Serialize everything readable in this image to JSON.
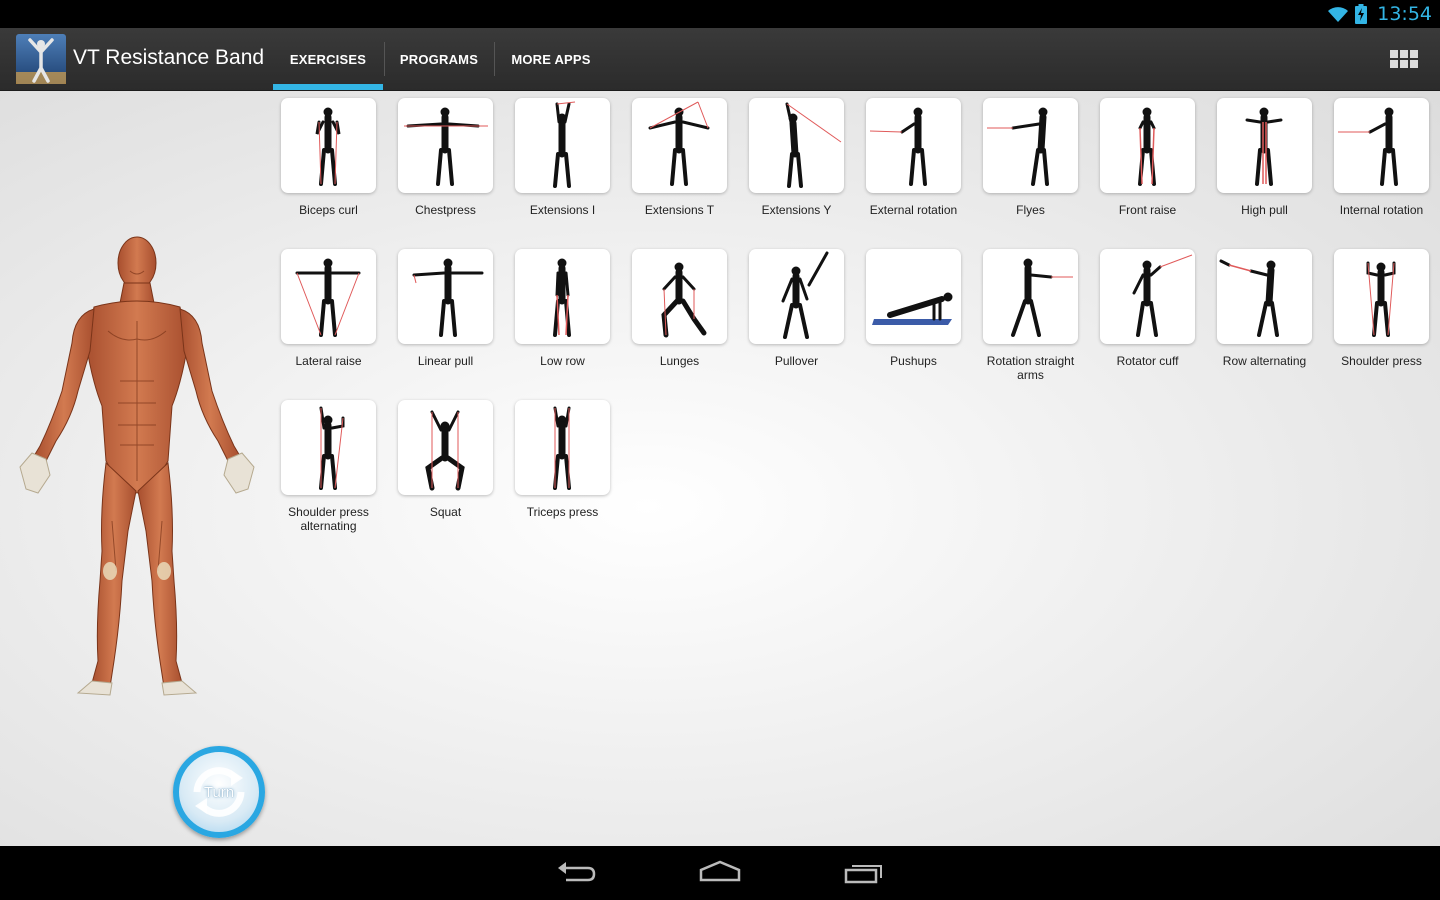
{
  "status_bar": {
    "time": "13:54",
    "icons": [
      "wifi-icon",
      "battery-charging-icon"
    ]
  },
  "app": {
    "title": "VT Resistance Band",
    "logo_icon": "muscle-figure-logo-icon"
  },
  "tabs": [
    {
      "label": "EXERCISES",
      "selected": true
    },
    {
      "label": "PROGRAMS",
      "selected": false
    },
    {
      "label": "MORE APPS",
      "selected": false
    }
  ],
  "menu_icon": "grid-view-icon",
  "turn_button": {
    "label": "Turn"
  },
  "exercises": [
    {
      "label": "Biceps curl"
    },
    {
      "label": "Chestpress"
    },
    {
      "label": "Extensions I"
    },
    {
      "label": "Extensions T"
    },
    {
      "label": "Extensions Y"
    },
    {
      "label": "External rotation"
    },
    {
      "label": "Flyes"
    },
    {
      "label": "Front raise"
    },
    {
      "label": "High pull"
    },
    {
      "label": "Internal rotation"
    },
    {
      "label": "Lateral raise"
    },
    {
      "label": "Linear pull"
    },
    {
      "label": "Low row"
    },
    {
      "label": "Lunges"
    },
    {
      "label": "Pullover"
    },
    {
      "label": "Pushups"
    },
    {
      "label": "Rotation straight arms"
    },
    {
      "label": "Rotator cuff"
    },
    {
      "label": "Row alternating"
    },
    {
      "label": "Shoulder press"
    },
    {
      "label": "Shoulder press alternating"
    },
    {
      "label": "Squat"
    },
    {
      "label": "Triceps press"
    }
  ],
  "nav_bar": {
    "icons": [
      "back-icon",
      "home-icon",
      "recent-apps-icon"
    ]
  },
  "colors": {
    "accent": "#33b5e5",
    "action_bar": "#2f2f2f",
    "muscle": "#c2643e"
  }
}
